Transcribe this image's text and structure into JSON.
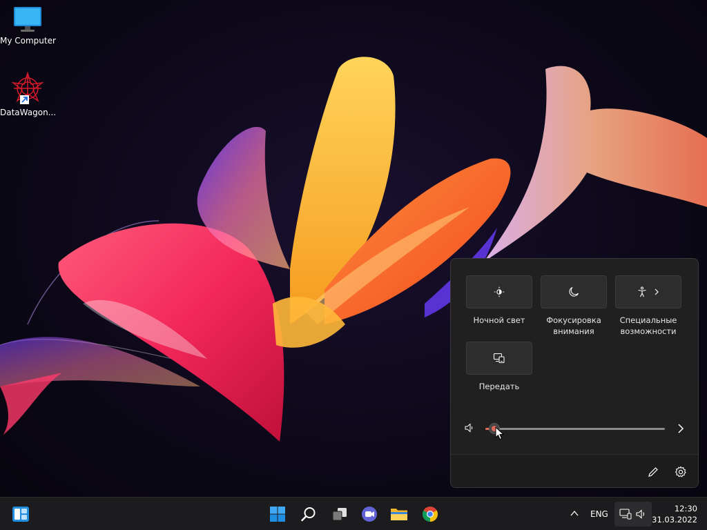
{
  "desktop": {
    "icons": [
      {
        "label": "My Computer"
      },
      {
        "label": "DataWagon..."
      }
    ]
  },
  "quick_settings": {
    "tiles": [
      {
        "label": "Ночной свет",
        "icon": "brightness-icon"
      },
      {
        "label": "Фокусировка внимания",
        "icon": "moon-icon"
      },
      {
        "label": "Специальные возможности",
        "icon": "accessibility-icon",
        "has_chevron": true
      },
      {
        "label": "Передать",
        "icon": "cast-icon"
      }
    ],
    "volume": {
      "level": 0.05,
      "icon": "speaker-icon"
    },
    "accent_color": "#e2695a"
  },
  "taskbar": {
    "language": "ENG",
    "time": "12:30",
    "date": "31.03.2022",
    "pinned": [
      "widgets",
      "start",
      "search",
      "task-view",
      "teams-chat",
      "file-explorer",
      "chrome"
    ]
  }
}
